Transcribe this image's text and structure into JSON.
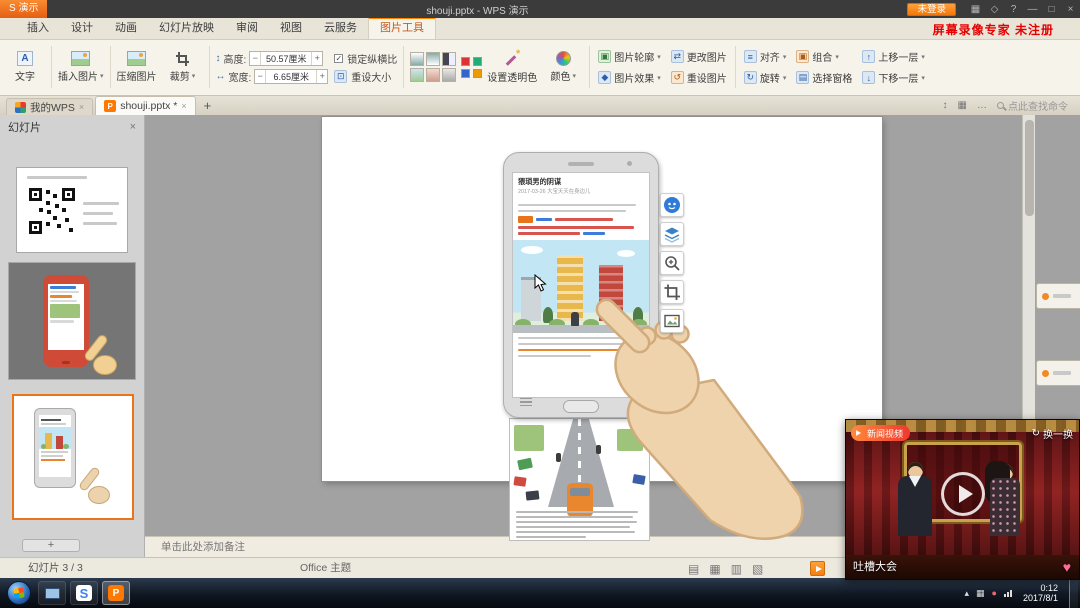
{
  "titlebar": {
    "app_tab": "S 演示",
    "title": "shouji.pptx - WPS 演示",
    "login_button": "未登录",
    "watermark": "屏幕录像专家 未注册"
  },
  "ribbon_tabs": [
    "插入",
    "设计",
    "动画",
    "幻灯片放映",
    "审阅",
    "视图",
    "云服务",
    "图片工具"
  ],
  "ribbon": {
    "insert_text": "文字",
    "insert_picture": "插入图片",
    "compress_picture": "压缩图片",
    "crop": "裁剪",
    "height_label": "高度:",
    "height_value": "50.57厘米",
    "width_label": "宽度:",
    "width_value": "6.65厘米",
    "lock_aspect": "锁定纵横比",
    "reset_size": "重设大小",
    "set_transparent": "设置透明色",
    "color": "颜色",
    "picture_outline": "图片轮廓",
    "picture_effects": "图片效果",
    "change_picture": "更改图片",
    "reset_picture": "重设图片",
    "align": "对齐",
    "rotate": "旋转",
    "group": "组合",
    "selection_pane": "选择窗格",
    "bring_forward": "上移一层",
    "send_backward": "下移一层"
  },
  "doc_tabs": {
    "tab1": "我的WPS",
    "tab2": "shouji.pptx *",
    "find_placeholder": "点此查找命令"
  },
  "slides_panel": {
    "title": "幻灯片"
  },
  "slide": {
    "article_title": "猥琐男的阴谋",
    "article_meta": "2017-03-26  大宝天天在身边儿"
  },
  "notes": {
    "placeholder": "单击此处添加备注"
  },
  "statusbar": {
    "slide_info": "幻灯片 3 / 3",
    "theme": "Office 主题"
  },
  "video": {
    "badge": "新闻视频",
    "refresh": "换一换",
    "show_title": "吐槽大会"
  },
  "tray": {
    "time": "0:12",
    "date": "2017/8/1"
  },
  "colors": {
    "wps_orange": "#ff7800",
    "active_tab_accent": "#ff8400",
    "watermark_red": "#e60000",
    "selection_orange": "#e9741c",
    "video_red": "#7e1a1c"
  }
}
